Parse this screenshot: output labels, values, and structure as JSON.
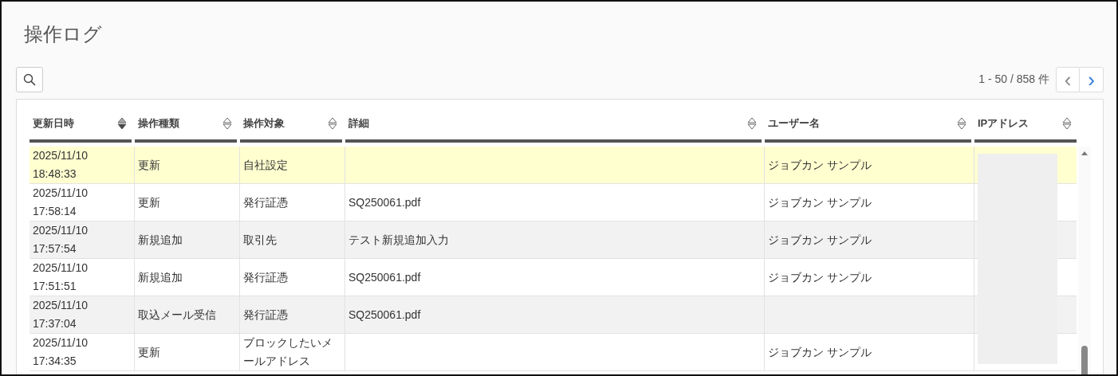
{
  "page": {
    "title": "操作ログ"
  },
  "pagination": {
    "summary": "1 - 50 / 858 件",
    "prev": {
      "label": "‹",
      "disabled": true
    },
    "next": {
      "label": "›",
      "disabled": false
    }
  },
  "table": {
    "columns": [
      {
        "label": "更新日時",
        "sorted_desc": true
      },
      {
        "label": "操作種類",
        "sorted_desc": false
      },
      {
        "label": "操作対象",
        "sorted_desc": false
      },
      {
        "label": "詳細",
        "sorted_desc": false
      },
      {
        "label": "ユーザー名",
        "sorted_desc": false
      },
      {
        "label": "IPアドレス",
        "sorted_desc": false
      }
    ],
    "rows": [
      {
        "selected": true,
        "cells": [
          "2025/11/10\n18:48:33",
          "更新",
          "自社設定",
          "",
          "ジョブカン サンプル"
        ]
      },
      {
        "selected": false,
        "cells": [
          "2025/11/10\n17:58:14",
          "更新",
          "発行証憑",
          "SQ250061.pdf",
          "ジョブカン サンプル"
        ]
      },
      {
        "selected": false,
        "cells": [
          "2025/11/10\n17:57:54",
          "新規追加",
          "取引先",
          "テスト新規追加入力",
          "ジョブカン サンプル"
        ]
      },
      {
        "selected": false,
        "cells": [
          "2025/11/10\n17:51:51",
          "新規追加",
          "発行証憑",
          "SQ250061.pdf",
          "ジョブカン サンプル"
        ]
      },
      {
        "selected": false,
        "cells": [
          "2025/11/10\n17:37:04",
          "取込メール受信",
          "発行証憑",
          "SQ250061.pdf",
          ""
        ]
      },
      {
        "selected": false,
        "cells": [
          "2025/11/10\n17:34:35",
          "更新",
          "ブロックしたいメールアドレス",
          "",
          "ジョブカン サンプル"
        ]
      }
    ]
  }
}
